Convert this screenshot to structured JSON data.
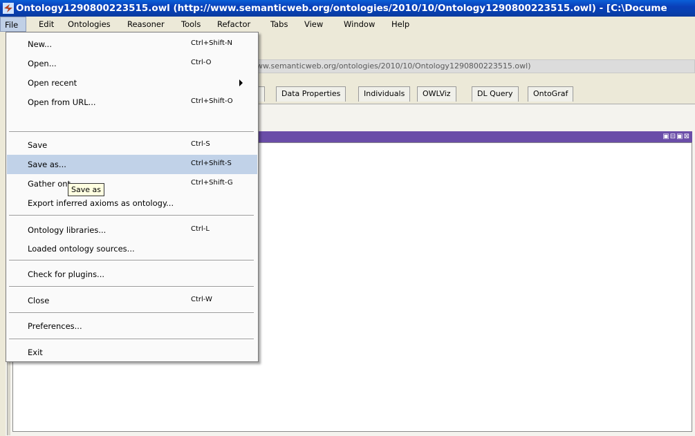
{
  "window": {
    "title": "Ontology1290800223515.owl (http://www.semanticweb.org/ontologies/2010/10/Ontology1290800223515.owl) - [C:\\Docume"
  },
  "menubar": [
    "File",
    "Edit",
    "Ontologies",
    "Reasoner",
    "Tools",
    "Refactor",
    "Tabs",
    "View",
    "Window",
    "Help"
  ],
  "url_text": "ww.semanticweb.org/ontologies/2010/10/Ontology1290800223515.owl)",
  "tabs": [
    "es",
    "Data Properties",
    "Individuals",
    "OWLViz",
    "DL Query",
    "OntoGraf"
  ],
  "file_menu": [
    {
      "label": "New...",
      "accel": "Ctrl+Shift-N"
    },
    {
      "label": "Open...",
      "accel": "Ctrl-O"
    },
    {
      "label": "Open recent",
      "accel": ""
    },
    {
      "label": "Open from URL...",
      "accel": "Ctrl+Shift-O"
    },
    {
      "label": "Save",
      "accel": "Ctrl-S"
    },
    {
      "label": "Save as...",
      "accel": "Ctrl+Shift-S"
    },
    {
      "label": "Gather ont",
      "accel": "Ctrl+Shift-G"
    },
    {
      "label": "Export inferred axioms as ontology...",
      "accel": ""
    },
    {
      "label": "Ontology libraries...",
      "accel": "Ctrl-L"
    },
    {
      "label": "Loaded ontology sources...",
      "accel": ""
    },
    {
      "label": "Check for plugins...",
      "accel": ""
    },
    {
      "label": "Close",
      "accel": "Ctrl-W"
    },
    {
      "label": "Preferences...",
      "accel": ""
    },
    {
      "label": "Exit",
      "accel": ""
    }
  ],
  "tooltip": "Save as",
  "view_buttons": "▣⊟▣⊠",
  "colors": {
    "titlebar": "#0a3fb8",
    "menu_highlight": "#c1d2e8",
    "view_header": "#6a4da8"
  }
}
